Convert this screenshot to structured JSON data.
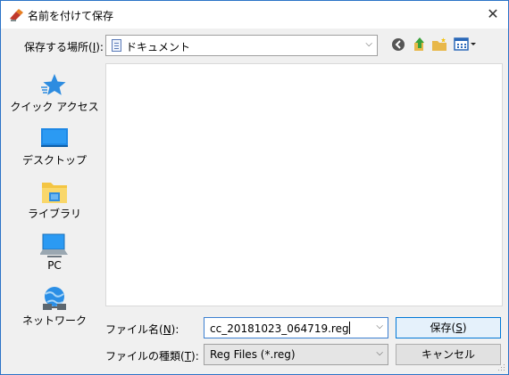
{
  "title": "名前を付けて保存",
  "location": {
    "label": "保存する場所(",
    "label_key": "I",
    "label_end": "):",
    "value": "ドキュメント"
  },
  "places": [
    {
      "label": "クイック アクセス",
      "icon": "star-icon"
    },
    {
      "label": "デスクトップ",
      "icon": "desktop-icon"
    },
    {
      "label": "ライブラリ",
      "icon": "library-folder-icon"
    },
    {
      "label": "PC",
      "icon": "pc-icon"
    },
    {
      "label": "ネットワーク",
      "icon": "network-icon"
    }
  ],
  "filename": {
    "label": "ファイル名(",
    "label_key": "N",
    "label_end": "):",
    "value": "cc_20181023_064719.reg"
  },
  "filetype": {
    "label": "ファイルの種類(",
    "label_key": "T",
    "label_end": "):",
    "value": "Reg Files (*.reg)"
  },
  "buttons": {
    "save": "保存(",
    "save_key": "S",
    "save_end": ")",
    "cancel": "キャンセル"
  },
  "colors": {
    "accent": "#0078d7",
    "star": "#2d8ce0"
  }
}
